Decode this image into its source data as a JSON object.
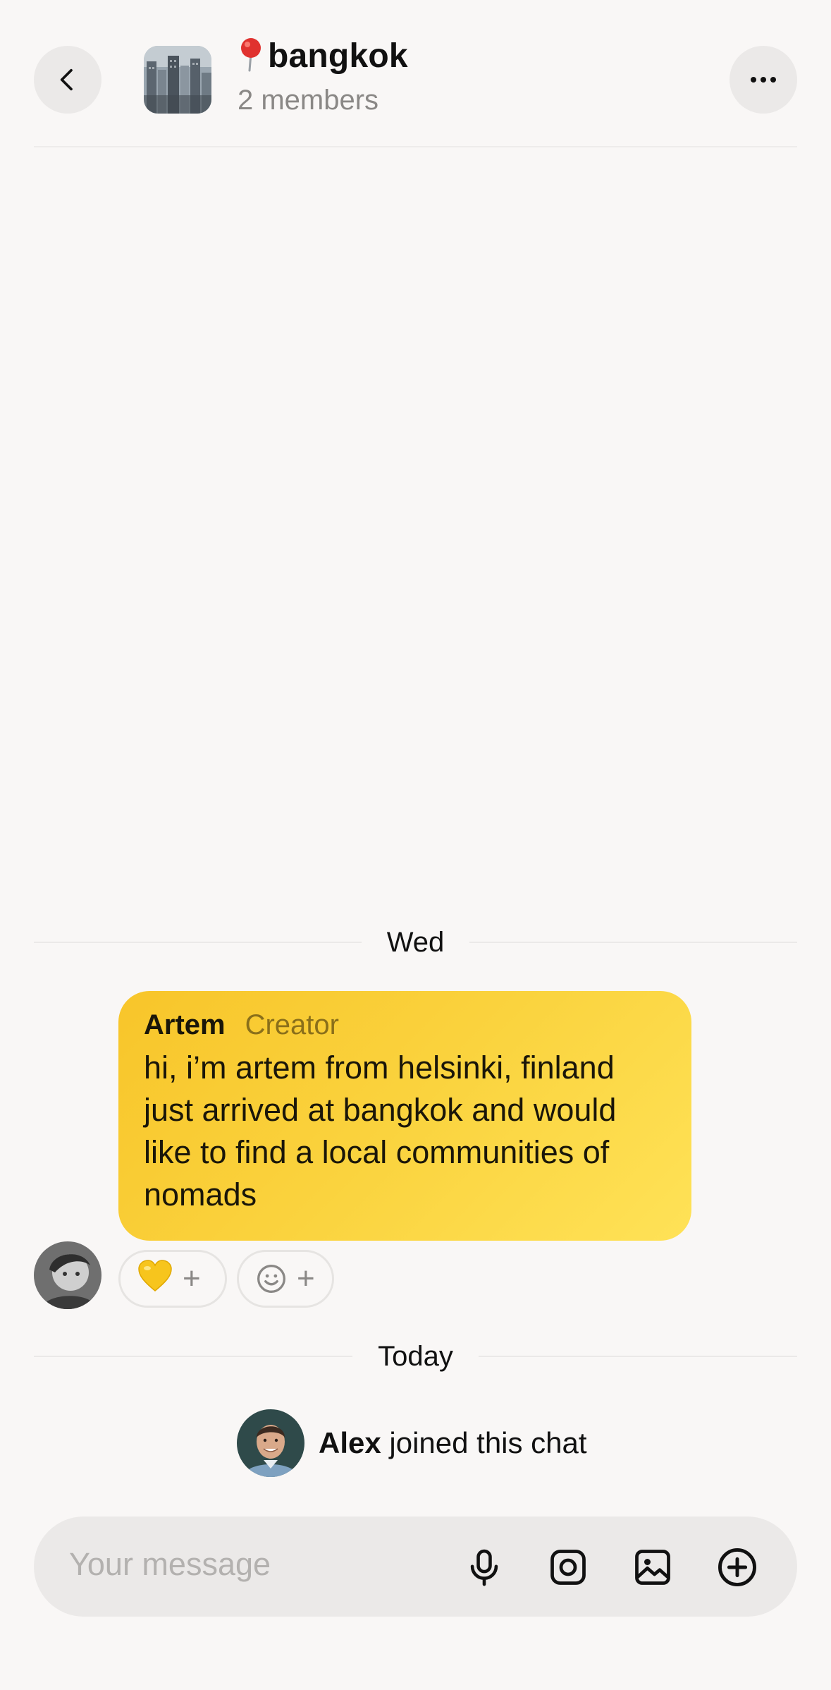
{
  "header": {
    "title_emoji": "📍",
    "title": "bangkok",
    "members": "2 members"
  },
  "messages": {
    "date_wed": "Wed",
    "sender": "Artem",
    "sender_role": "Creator",
    "text": "hi, i’m artem from helsinki, finland just arrived at bangkok and would like to find a local communities of nomads",
    "reactions": [
      {
        "emoji": "💛",
        "plus": "+"
      },
      {
        "icon": "smiley-icon",
        "plus": "+"
      }
    ],
    "date_today": "Today",
    "joined_name": "Alex",
    "joined_suffix": " joined this chat"
  },
  "composer": {
    "placeholder": "Your message",
    "icons": [
      "microphone-icon",
      "camera-icon",
      "gallery-icon",
      "plus-circle-icon"
    ]
  },
  "colors": {
    "background": "#f9f7f6",
    "bubble": "#fad33e",
    "muted": "#8a8886"
  }
}
